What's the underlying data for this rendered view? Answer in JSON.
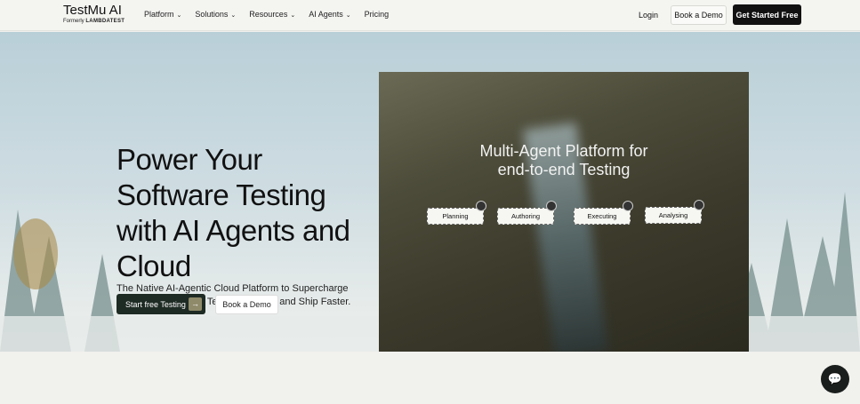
{
  "nav": {
    "brand": "TestMu AI",
    "formerly": "Formerly",
    "formerly_brand": "LAMBDATEST",
    "menu": [
      "Platform",
      "Solutions",
      "Resources",
      "AI Agents",
      "Pricing"
    ],
    "login": "Login",
    "book_demo": "Book a Demo",
    "get_started": "Get Started Free"
  },
  "hero": {
    "title": "Power Your Software Testing with AI Agents and Cloud",
    "subtitle": "The Native AI-Agentic Cloud Platform to Supercharge Quality Engineering. Test Intelligently and Ship Faster.",
    "primary_cta": "Start free Testing",
    "secondary_cta": "Book a Demo"
  },
  "media": {
    "title_line1": "Multi-Agent Platform for",
    "title_line2": "end-to-end Testing",
    "stages": [
      "Planning",
      "Authoring",
      "Executing",
      "Analysing"
    ]
  }
}
